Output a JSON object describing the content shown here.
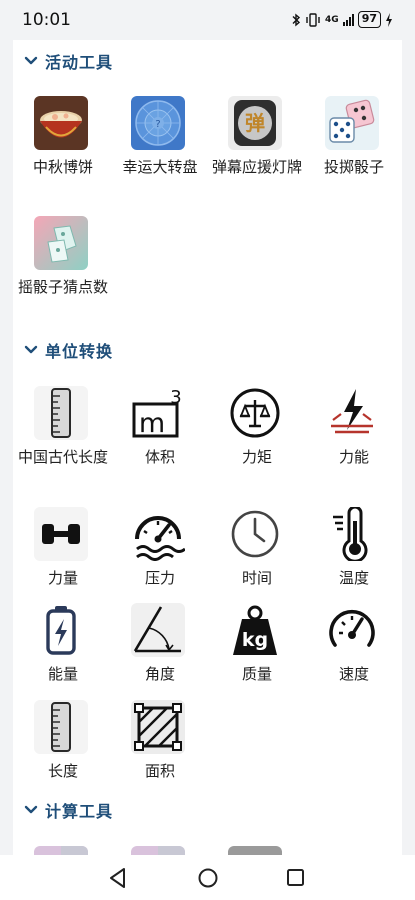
{
  "status_bar": {
    "time": "10:01",
    "network": "4G",
    "battery": "97"
  },
  "sections": {
    "activity": {
      "title": "活动工具",
      "items": [
        {
          "label": "中秋博饼",
          "icon": "mooncake-bowl-icon"
        },
        {
          "label": "幸运大转盘",
          "icon": "lucky-wheel-icon"
        },
        {
          "label": "弹幕应援灯牌",
          "icon": "danmaku-sign-icon"
        },
        {
          "label": "投掷骰子",
          "icon": "dice-icon"
        },
        {
          "label": "摇骰子猜点数",
          "icon": "dice-guess-icon"
        }
      ]
    },
    "unit": {
      "title": "单位转换",
      "items": [
        {
          "label": "中国古代长度",
          "icon": "ruler-icon"
        },
        {
          "label": "体积",
          "icon": "cubic-meter-icon"
        },
        {
          "label": "力矩",
          "icon": "balance-scale-icon"
        },
        {
          "label": "力能",
          "icon": "energy-bolt-icon"
        },
        {
          "label": "力量",
          "icon": "dumbbell-icon"
        },
        {
          "label": "压力",
          "icon": "pressure-gauge-icon"
        },
        {
          "label": "时间",
          "icon": "clock-icon"
        },
        {
          "label": "温度",
          "icon": "thermometer-icon"
        },
        {
          "label": "能量",
          "icon": "battery-icon"
        },
        {
          "label": "角度",
          "icon": "angle-icon"
        },
        {
          "label": "质量",
          "icon": "kg-weight-icon"
        },
        {
          "label": "速度",
          "icon": "speedometer-icon"
        },
        {
          "label": "长度",
          "icon": "ruler-icon"
        },
        {
          "label": "面积",
          "icon": "area-square-icon"
        }
      ]
    },
    "calc": {
      "title": "计算工具"
    }
  },
  "colors": {
    "section_title": "#1f4e79",
    "background": "#f2f3f5",
    "card": "#ffffff"
  }
}
